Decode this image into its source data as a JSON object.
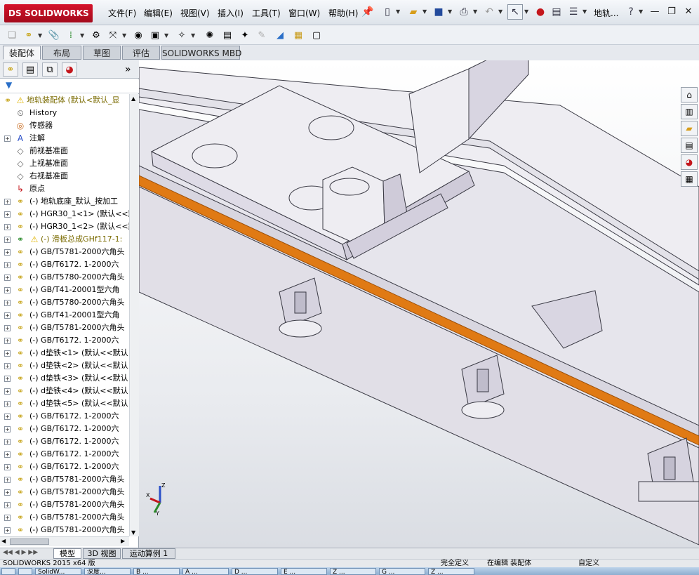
{
  "app": {
    "logo_text": "SOLIDWORKS",
    "logo_prefix": "DS",
    "doc_name": "地轨..."
  },
  "menu": [
    "文件(F)",
    "编辑(E)",
    "视图(V)",
    "插入(I)",
    "工具(T)",
    "窗口(W)",
    "帮助(H)"
  ],
  "title_icons": [
    "pin-icon",
    "new-document-icon",
    "open-folder-icon",
    "save-icon",
    "print-icon",
    "undo-icon",
    "select-pointer-icon",
    "rebuild-icon",
    "file-properties-icon",
    "options-icon",
    "help-icon"
  ],
  "cm_tabs": [
    "装配体",
    "布局",
    "草图",
    "评估",
    "SOLIDWORKS MBD"
  ],
  "cm_active": "装配体",
  "tree": [
    {
      "label": "地轨装配体  (默认<默认_显",
      "icon": "assembly-warning",
      "expand": "",
      "indent": 0,
      "color": "#7a6b00"
    },
    {
      "label": "History",
      "icon": "history",
      "expand": "",
      "indent": 1,
      "color": "#000"
    },
    {
      "label": "传感器",
      "icon": "sensor",
      "expand": "",
      "indent": 1,
      "color": "#000"
    },
    {
      "label": "注解",
      "icon": "annotation",
      "expand": "+",
      "indent": 1,
      "color": "#000"
    },
    {
      "label": "前视基准面",
      "icon": "plane",
      "expand": "",
      "indent": 1,
      "color": "#000"
    },
    {
      "label": "上视基准面",
      "icon": "plane",
      "expand": "",
      "indent": 1,
      "color": "#000"
    },
    {
      "label": "右视基准面",
      "icon": "plane",
      "expand": "",
      "indent": 1,
      "color": "#000"
    },
    {
      "label": "原点",
      "icon": "origin",
      "expand": "",
      "indent": 1,
      "color": "#000"
    },
    {
      "label": "(-) 地轨底座_默认_按加工",
      "icon": "part",
      "expand": "+",
      "indent": 1,
      "color": "#000"
    },
    {
      "label": "(-) HGR30_1<1> (默认<<默",
      "icon": "part",
      "expand": "+",
      "indent": 1,
      "color": "#000"
    },
    {
      "label": "(-) HGR30_1<2> (默认<<默",
      "icon": "part",
      "expand": "+",
      "indent": 1,
      "color": "#000"
    },
    {
      "label": "(-) 滑板总成GHf117-1:",
      "icon": "subassembly-warning",
      "expand": "+",
      "indent": 1,
      "color": "#7a6b00"
    },
    {
      "label": "(-) GB/T5781-2000六角头",
      "icon": "part",
      "expand": "+",
      "indent": 1,
      "color": "#000"
    },
    {
      "label": "(-) GB/T6172. 1-2000六",
      "icon": "part",
      "expand": "+",
      "indent": 1,
      "color": "#000"
    },
    {
      "label": "(-) GB/T5780-2000六角头",
      "icon": "part",
      "expand": "+",
      "indent": 1,
      "color": "#000"
    },
    {
      "label": "(-) GB/T41-20001型六角",
      "icon": "part",
      "expand": "+",
      "indent": 1,
      "color": "#000"
    },
    {
      "label": "(-) GB/T5780-2000六角头",
      "icon": "part",
      "expand": "+",
      "indent": 1,
      "color": "#000"
    },
    {
      "label": "(-) GB/T41-20001型六角",
      "icon": "part",
      "expand": "+",
      "indent": 1,
      "color": "#000"
    },
    {
      "label": "(-) GB/T5781-2000六角头",
      "icon": "part",
      "expand": "+",
      "indent": 1,
      "color": "#000"
    },
    {
      "label": "(-) GB/T6172. 1-2000六",
      "icon": "part",
      "expand": "+",
      "indent": 1,
      "color": "#000"
    },
    {
      "label": "(-) d垫铁<1> (默认<<默认",
      "icon": "part",
      "expand": "+",
      "indent": 1,
      "color": "#000"
    },
    {
      "label": "(-) d垫铁<2> (默认<<默认",
      "icon": "part",
      "expand": "+",
      "indent": 1,
      "color": "#000"
    },
    {
      "label": "(-) d垫铁<3> (默认<<默认",
      "icon": "part",
      "expand": "+",
      "indent": 1,
      "color": "#000"
    },
    {
      "label": "(-) d垫铁<4> (默认<<默认",
      "icon": "part",
      "expand": "+",
      "indent": 1,
      "color": "#000"
    },
    {
      "label": "(-) d垫铁<5> (默认<<默认",
      "icon": "part",
      "expand": "+",
      "indent": 1,
      "color": "#000"
    },
    {
      "label": "(-) GB/T6172. 1-2000六",
      "icon": "part",
      "expand": "+",
      "indent": 1,
      "color": "#000"
    },
    {
      "label": "(-) GB/T6172. 1-2000六",
      "icon": "part",
      "expand": "+",
      "indent": 1,
      "color": "#000"
    },
    {
      "label": "(-) GB/T6172. 1-2000六",
      "icon": "part",
      "expand": "+",
      "indent": 1,
      "color": "#000"
    },
    {
      "label": "(-) GB/T6172. 1-2000六",
      "icon": "part",
      "expand": "+",
      "indent": 1,
      "color": "#000"
    },
    {
      "label": "(-) GB/T6172. 1-2000六",
      "icon": "part",
      "expand": "+",
      "indent": 1,
      "color": "#000"
    },
    {
      "label": "(-) GB/T5781-2000六角头",
      "icon": "part",
      "expand": "+",
      "indent": 1,
      "color": "#000"
    },
    {
      "label": "(-) GB/T5781-2000六角头",
      "icon": "part",
      "expand": "+",
      "indent": 1,
      "color": "#000"
    },
    {
      "label": "(-) GB/T5781-2000六角头",
      "icon": "part",
      "expand": "+",
      "indent": 1,
      "color": "#000"
    },
    {
      "label": "(-) GB/T5781-2000六角头",
      "icon": "part",
      "expand": "+",
      "indent": 1,
      "color": "#000"
    },
    {
      "label": "(-) GB/T5781-2000六角头",
      "icon": "part",
      "expand": "+",
      "indent": 1,
      "color": "#000"
    }
  ],
  "bottom_tabs": [
    "模型",
    "3D 视图",
    "运动算例 1"
  ],
  "bottom_active": "模型",
  "status": {
    "left": "SOLIDWORKS 2015 x64 版",
    "right1": "完全定义",
    "right2": "在编辑 装配体",
    "right3": "自定义"
  },
  "taskbar": [
    "",
    "",
    "SolidW...",
    "深度...",
    "B ...",
    "A ...",
    "D ...",
    "E ...",
    "Z ...",
    "G ...",
    "Z ..."
  ],
  "triad": {
    "x": "X",
    "y": "Y",
    "z": "Z"
  },
  "colors": {
    "accent_orange": "#e07a14",
    "part_face": "#eeedf2",
    "shadow_face": "#cbc8d6",
    "warning": "#e0b400"
  }
}
